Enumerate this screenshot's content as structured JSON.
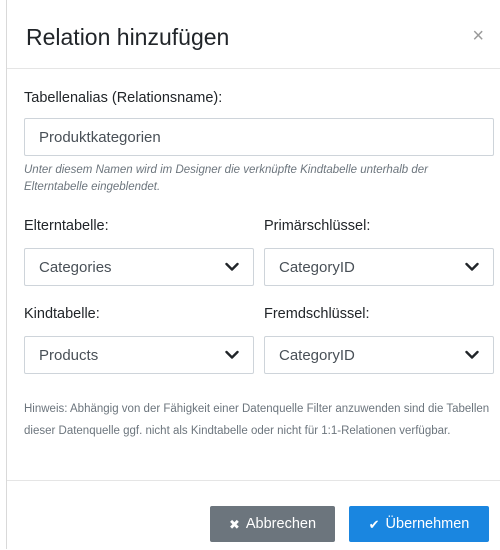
{
  "dialog": {
    "title": "Relation hinzufügen",
    "close_glyph": "×"
  },
  "alias": {
    "label": "Tabellenalias (Relationsname):",
    "value": "Produktkategorien",
    "hint": "Unter diesem Namen wird im Designer die verknüpfte Kindtabelle unterhalb der Elterntabelle eingeblendet."
  },
  "parent_table": {
    "label": "Elterntabelle:",
    "selected": "Categories"
  },
  "primary_key": {
    "label": "Primärschlüssel:",
    "selected": "CategoryID"
  },
  "child_table": {
    "label": "Kindtabelle:",
    "selected": "Products"
  },
  "foreign_key": {
    "label": "Fremdschlüssel:",
    "selected": "CategoryID"
  },
  "note": "Hinweis: Abhängig von der Fähigkeit einer Datenquelle Filter anzuwenden sind die Tabellen dieser Datenquelle ggf. nicht als Kindtabelle oder nicht für 1:1-Relationen verfügbar.",
  "footer": {
    "cancel_label": "Abbrechen",
    "cancel_icon": "✖",
    "ok_label": "Übernehmen",
    "ok_icon": "✔"
  },
  "icons": {
    "close": "close-icon",
    "dropdown": "chevron-down-icon",
    "cancel": "x-icon",
    "ok": "check-icon"
  },
  "colors": {
    "primary": "#1a86e0",
    "secondary": "#6c757d"
  }
}
